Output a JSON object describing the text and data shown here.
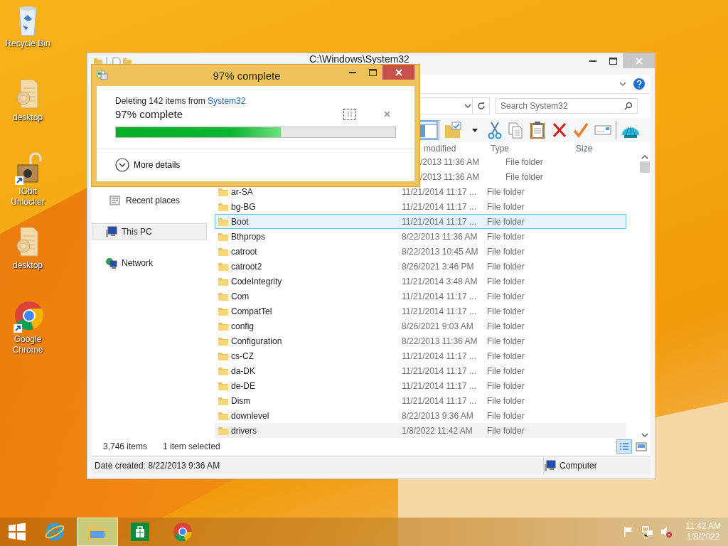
{
  "desktop_icons": [
    {
      "label": "Recycle Bin",
      "kind": "recycle"
    },
    {
      "label": "desktop",
      "kind": "file"
    },
    {
      "label": "IObit Unlocker",
      "kind": "unlocker"
    },
    {
      "label": "desktop",
      "kind": "file"
    },
    {
      "label": "Google Chrome",
      "kind": "chrome"
    }
  ],
  "explorer": {
    "title": "C:\\Windows\\System32",
    "search": {
      "placeholder": "Search System32"
    },
    "toolbar": [
      {
        "kind": "pane",
        "selected": true
      },
      {
        "kind": "properties",
        "selected": false
      },
      {
        "kind": "caret",
        "selected": false
      },
      {
        "kind": "cut",
        "selected": false
      },
      {
        "kind": "copy",
        "selected": false
      },
      {
        "kind": "paste",
        "selected": false
      },
      {
        "kind": "delete",
        "selected": false
      },
      {
        "kind": "check",
        "selected": false
      },
      {
        "kind": "rename",
        "selected": false
      },
      {
        "kind": "shell",
        "selected": false
      }
    ],
    "nav": [
      {
        "label": "Recent places",
        "kind": "recent",
        "selected": false
      },
      {
        "label": "This PC",
        "kind": "pc",
        "selected": true
      },
      {
        "label": "Network",
        "kind": "network",
        "selected": false
      }
    ],
    "columns": [
      "modified",
      "Type",
      "Size"
    ],
    "rows": [
      {
        "name": "",
        "date": "/2013 11:36 AM",
        "type": "File folder",
        "covered": true,
        "selected": false,
        "hovered": false
      },
      {
        "name": "",
        "date": "/2013 11:36 AM",
        "type": "File folder",
        "covered": true,
        "selected": false,
        "hovered": false
      },
      {
        "name": "ar-SA",
        "date": "11/21/2014 11:17 ...",
        "type": "File folder",
        "covered": false,
        "selected": false,
        "hovered": false
      },
      {
        "name": "bg-BG",
        "date": "11/21/2014 11:17 ...",
        "type": "File folder",
        "covered": false,
        "selected": false,
        "hovered": false
      },
      {
        "name": "Boot",
        "date": "11/21/2014 11:17 ...",
        "type": "File folder",
        "covered": false,
        "selected": true,
        "hovered": false
      },
      {
        "name": "Bthprops",
        "date": "8/22/2013 11:36 AM",
        "type": "File folder",
        "covered": false,
        "selected": false,
        "hovered": false
      },
      {
        "name": "catroot",
        "date": "8/22/2013 10:45 AM",
        "type": "File folder",
        "covered": false,
        "selected": false,
        "hovered": false
      },
      {
        "name": "catroot2",
        "date": "8/26/2021 3:46 PM",
        "type": "File folder",
        "covered": false,
        "selected": false,
        "hovered": false
      },
      {
        "name": "CodeIntegrity",
        "date": "11/21/2014 3:48 AM",
        "type": "File folder",
        "covered": false,
        "selected": false,
        "hovered": false
      },
      {
        "name": "Com",
        "date": "11/21/2014 11:17 ...",
        "type": "File folder",
        "covered": false,
        "selected": false,
        "hovered": false
      },
      {
        "name": "CompatTel",
        "date": "11/21/2014 11:17 ...",
        "type": "File folder",
        "covered": false,
        "selected": false,
        "hovered": false
      },
      {
        "name": "config",
        "date": "8/26/2021 9:03 AM",
        "type": "File folder",
        "covered": false,
        "selected": false,
        "hovered": false
      },
      {
        "name": "Configuration",
        "date": "8/22/2013 11:36 AM",
        "type": "File folder",
        "covered": false,
        "selected": false,
        "hovered": false
      },
      {
        "name": "cs-CZ",
        "date": "11/21/2014 11:17 ...",
        "type": "File folder",
        "covered": false,
        "selected": false,
        "hovered": false
      },
      {
        "name": "da-DK",
        "date": "11/21/2014 11:17 ...",
        "type": "File folder",
        "covered": false,
        "selected": false,
        "hovered": false
      },
      {
        "name": "de-DE",
        "date": "11/21/2014 11:17 ...",
        "type": "File folder",
        "covered": false,
        "selected": false,
        "hovered": false
      },
      {
        "name": "Dism",
        "date": "11/21/2014 11:17 ...",
        "type": "File folder",
        "covered": false,
        "selected": false,
        "hovered": false
      },
      {
        "name": "downlevel",
        "date": "8/22/2013 9:36 AM",
        "type": "File folder",
        "covered": false,
        "selected": false,
        "hovered": false
      },
      {
        "name": "drivers",
        "date": "1/8/2022 11:42 AM",
        "type": "File folder",
        "covered": false,
        "selected": false,
        "hovered": true
      }
    ],
    "item_count": "3,746 items",
    "selection": "1 item selected",
    "views": [
      {
        "kind": "details",
        "selected": true
      },
      {
        "kind": "large",
        "selected": false
      }
    ],
    "status_bar": {
      "text": "Date created: 8/22/2013 9:36 AM",
      "location": "Computer"
    }
  },
  "dialog": {
    "title": "97% complete",
    "message": "Deleting 142 items from",
    "source": "System32",
    "progress_text": "97% complete",
    "level": 0.59,
    "more": "More details"
  },
  "taskbar": {
    "apps": [
      {
        "kind": "ie",
        "selected": false
      },
      {
        "kind": "explorer",
        "selected": true
      },
      {
        "kind": "store",
        "selected": false
      },
      {
        "kind": "chrome",
        "selected": false
      }
    ],
    "tray": [
      {
        "kind": "flag"
      },
      {
        "kind": "network"
      },
      {
        "kind": "volume-muted"
      }
    ],
    "time": "11:42 AM",
    "date": "1/8/2022"
  }
}
